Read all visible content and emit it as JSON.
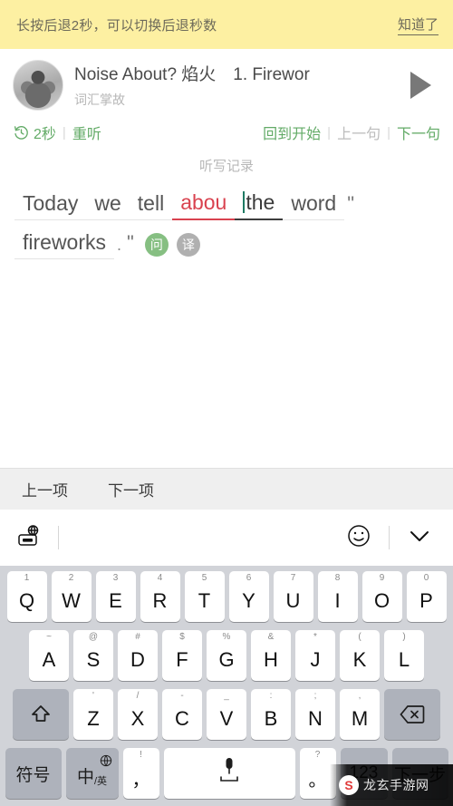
{
  "hint_banner": {
    "message": "长按后退2秒，可以切换后退秒数",
    "action_label": "知道了"
  },
  "player": {
    "title": "Noise About? 焰火　1. Firewor",
    "subtitle": "词汇掌故",
    "avatar_icon": "podcast-avatar",
    "play_icon": "play-icon"
  },
  "controls": {
    "rewind_icon": "rewind-circular-arrow-icon",
    "rewind_seconds": "2秒",
    "replay_label": "重听",
    "back_to_start_label": "回到开始",
    "prev_sentence_label": "上一句",
    "next_sentence_label": "下一句",
    "separator": "|"
  },
  "dictation": {
    "section_label": "听写记录",
    "line1": [
      {
        "text": "Today",
        "state": "normal"
      },
      {
        "text": "we",
        "state": "normal"
      },
      {
        "text": "tell",
        "state": "normal"
      },
      {
        "text": "abou",
        "state": "error"
      },
      {
        "text": "the",
        "state": "current"
      },
      {
        "text": "word",
        "state": "normal"
      },
      {
        "text": "\"",
        "state": "punct"
      }
    ],
    "line2": [
      {
        "text": "fireworks",
        "state": "normal"
      },
      {
        "text": ".",
        "state": "punct-small"
      },
      {
        "text": "\"",
        "state": "punct"
      }
    ],
    "badges": [
      {
        "label": "问",
        "kind": "ask"
      },
      {
        "label": "译",
        "kind": "trans"
      }
    ]
  },
  "keyboard": {
    "nav": {
      "prev_label": "上一项",
      "next_label": "下一项"
    },
    "toolbar": {
      "globe_keyboard_icon": "globe-keyboard-icon",
      "emoji_icon": "smiley-icon",
      "collapse_icon": "chevron-down-icon"
    },
    "rows": [
      [
        {
          "glyph": "Q",
          "hint": "1"
        },
        {
          "glyph": "W",
          "hint": "2"
        },
        {
          "glyph": "E",
          "hint": "3"
        },
        {
          "glyph": "R",
          "hint": "4"
        },
        {
          "glyph": "T",
          "hint": "5"
        },
        {
          "glyph": "Y",
          "hint": "6"
        },
        {
          "glyph": "U",
          "hint": "7"
        },
        {
          "glyph": "I",
          "hint": "8"
        },
        {
          "glyph": "O",
          "hint": "9"
        },
        {
          "glyph": "P",
          "hint": "0"
        }
      ],
      [
        {
          "glyph": "A",
          "hint": "~"
        },
        {
          "glyph": "S",
          "hint": "@"
        },
        {
          "glyph": "D",
          "hint": "#"
        },
        {
          "glyph": "F",
          "hint": "$"
        },
        {
          "glyph": "G",
          "hint": "%"
        },
        {
          "glyph": "H",
          "hint": "&"
        },
        {
          "glyph": "J",
          "hint": "*"
        },
        {
          "glyph": "K",
          "hint": "("
        },
        {
          "glyph": "L",
          "hint": ")"
        }
      ],
      [
        {
          "glyph": "Z",
          "hint": "'"
        },
        {
          "glyph": "X",
          "hint": "/"
        },
        {
          "glyph": "C",
          "hint": "-"
        },
        {
          "glyph": "V",
          "hint": "_"
        },
        {
          "glyph": "B",
          "hint": ":"
        },
        {
          "glyph": "N",
          "hint": ";"
        },
        {
          "glyph": "M",
          "hint": ","
        }
      ]
    ],
    "shift_icon": "shift-arrow-icon",
    "backspace_icon": "backspace-icon",
    "bottom": {
      "symbols_label": "符号",
      "lang_main": "中",
      "lang_sub": "/英",
      "lang_globe_icon": "globe-icon",
      "comma_hint": "!",
      "comma_glyph": "，",
      "space_mic_icon": "microphone-icon",
      "period_hint": "?",
      "period_glyph": "。",
      "numbers_label": "123",
      "enter_label": "下一步"
    }
  },
  "watermark": {
    "text": "龙玄手游网",
    "logo": "S"
  }
}
